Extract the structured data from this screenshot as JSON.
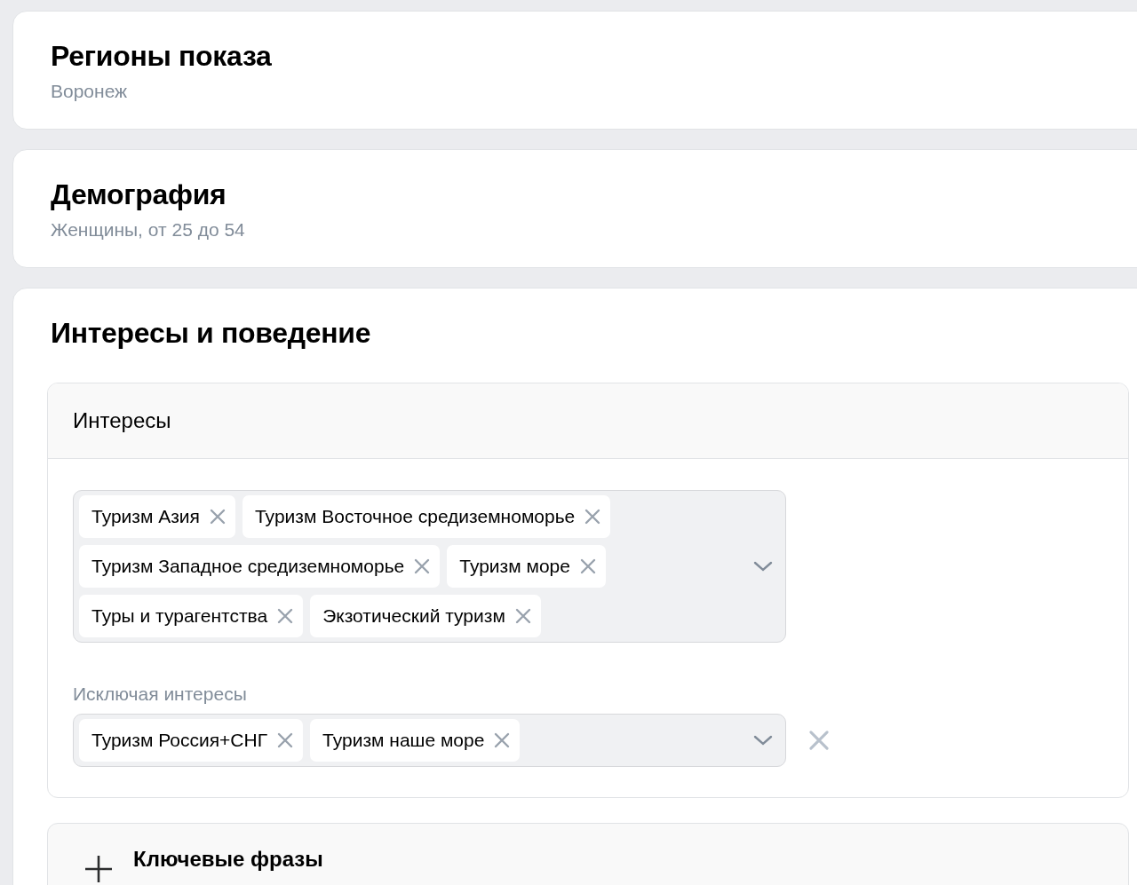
{
  "sections": [
    {
      "title": "Регионы показа",
      "summary": "Воронеж"
    },
    {
      "title": "Демография",
      "summary": "Женщины, от 25 до 54"
    }
  ],
  "interests_section": {
    "title": "Интересы и поведение",
    "interests_panel": {
      "title": "Интересы",
      "included": [
        "Туризм Азия",
        "Туризм Восточное средиземноморье",
        "Туризм Западное средиземноморье",
        "Туризм море",
        "Туры и турагентства",
        "Экзотический туризм"
      ],
      "excluded_label": "Исключая интересы",
      "excluded": [
        "Туризм Россия+СНГ",
        "Туризм наше море"
      ]
    },
    "add_panel": {
      "title": "Ключевые фразы"
    }
  }
}
